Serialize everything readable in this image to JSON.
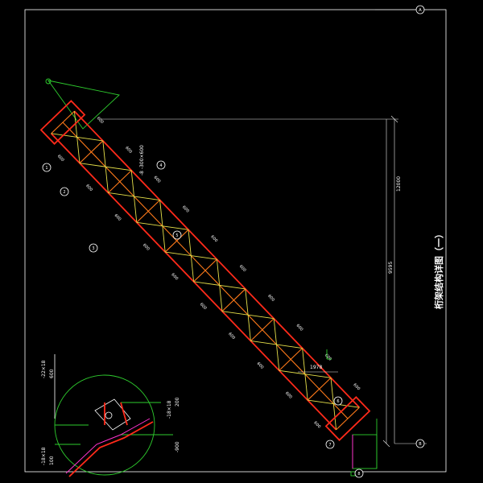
{
  "drawing": {
    "title": "桁架结构详图（一）",
    "colors": {
      "background": "#000000",
      "frame": "#ffffff",
      "chord": "#ff2a1a",
      "diagonal": "#e6e04a",
      "vertical": "#ff7a1a",
      "callout": "#2ecc2e",
      "highlight": "#ff33cc"
    },
    "dimensions": {
      "vertical_total": "12000",
      "vertical_mid": "9595",
      "horizontal_span": "1978"
    },
    "spacing_label": "600",
    "section_label": "-8 -300×600",
    "detail_labels": {
      "label_1": "-22×18",
      "label_2": "600",
      "label_3": "-18×18",
      "label_4": "200",
      "label_5": "100",
      "label_6": "-900",
      "label_7": "-18×18"
    },
    "bubbles": [
      "1",
      "2",
      "3",
      "4",
      "5",
      "6",
      "7",
      "8"
    ],
    "grid_marks": [
      "A",
      "B"
    ]
  }
}
